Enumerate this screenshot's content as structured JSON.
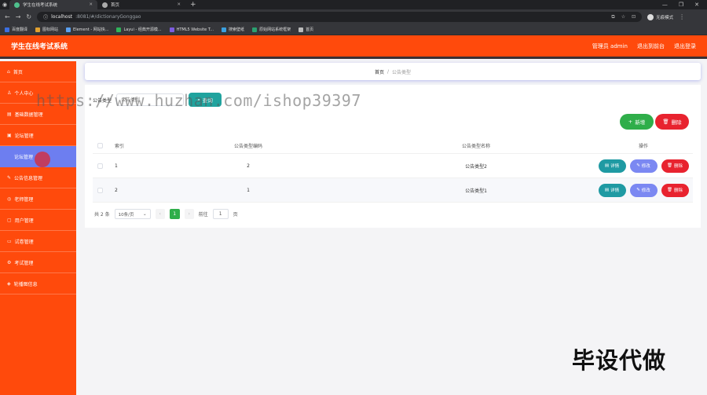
{
  "browser": {
    "tabs": [
      {
        "title": "学生在线考试系统",
        "active": true
      },
      {
        "title": "首页",
        "active": false
      }
    ],
    "url_host": "localhost",
    "url_path": ":8081/#/dictionaryGonggao",
    "profile_label": "无痕模式",
    "bookmarks": [
      {
        "label": "百度翻译",
        "color": "#3b6fe0"
      },
      {
        "label": "图标网站",
        "color": "#e0a030"
      },
      {
        "label": "Element - 网站快...",
        "color": "#5aa0f0"
      },
      {
        "label": "Layui - 经典开源模...",
        "color": "#2fb35a"
      },
      {
        "label": "HTML5 Website T...",
        "color": "#7c5ce0"
      },
      {
        "label": "搜索壁纸",
        "color": "#3aa0e0"
      },
      {
        "label": "原始网站系统框架",
        "color": "#2aa070"
      },
      {
        "label": "首页",
        "color": "#bbbbbb"
      }
    ]
  },
  "header": {
    "title": "学生在线考试系统",
    "user": "管理员 admin",
    "back_label": "退出到前台",
    "logout_label": "退出登录"
  },
  "sidebar": {
    "items": [
      {
        "label": "首页",
        "icon": "home-icon"
      },
      {
        "label": "个人中心",
        "icon": "user-icon"
      },
      {
        "label": "基础数据管理",
        "icon": "database-icon"
      },
      {
        "label": "论坛管理",
        "icon": "forum-icon"
      },
      {
        "label": "论坛管理",
        "icon": "",
        "sub": true
      },
      {
        "label": "公告信息管理",
        "icon": "notice-icon"
      },
      {
        "label": "老师管理",
        "icon": "teacher-icon"
      },
      {
        "label": "用户管理",
        "icon": "users-icon"
      },
      {
        "label": "试卷管理",
        "icon": "paper-icon"
      },
      {
        "label": "考试管理",
        "icon": "exam-icon"
      },
      {
        "label": "轮播图信息",
        "icon": "image-icon"
      }
    ]
  },
  "breadcrumb": {
    "home": "首页",
    "sep": "/",
    "current": "公告类型"
  },
  "search": {
    "label": "公告类型",
    "placeholder": "公告类型",
    "query_label": "查询"
  },
  "actions": {
    "add_label": "新增",
    "delete_label": "删除"
  },
  "table": {
    "headers": {
      "index": "索引",
      "code": "公告类型编码",
      "name": "公告类型名称",
      "ops": "操作"
    },
    "rows": [
      {
        "index": "1",
        "code": "2",
        "name": "公告类型2"
      },
      {
        "index": "2",
        "code": "1",
        "name": "公告类型1"
      }
    ],
    "row_actions": {
      "detail": "详情",
      "edit": "修改",
      "delete": "删除"
    }
  },
  "pagination": {
    "total": "共 2 条",
    "page_size": "10条/页",
    "current_page": "1",
    "goto_label": "前往",
    "goto_value": "1",
    "page_suffix": "页"
  },
  "overlay": {
    "watermark": "https://www.huzhan.com/ishop39397",
    "stamp": "毕设代做"
  }
}
